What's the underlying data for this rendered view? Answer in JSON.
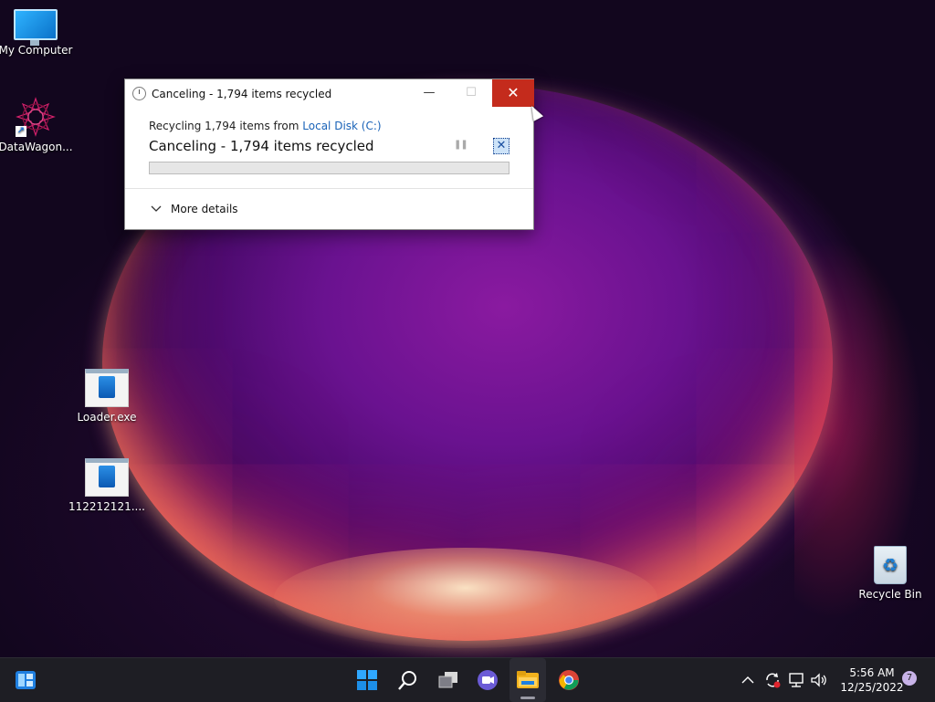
{
  "desktop": {
    "icons": [
      {
        "label": "My Computer"
      },
      {
        "label": "DataWagon..."
      },
      {
        "label": "Loader.exe"
      },
      {
        "label": "112212121...."
      },
      {
        "label": "Recycle Bin"
      }
    ]
  },
  "dialog": {
    "title": "Canceling - 1,794 items recycled",
    "from_prefix": "Recycling 1,794 items from ",
    "from_location": "Local Disk (C:)",
    "status": "Canceling - 1,794 items recycled",
    "progress": 0,
    "more_details": "More details",
    "minimize_glyph": "—",
    "maximize_glyph": "☐",
    "close_glyph": "✕",
    "pause_glyph": "❚❚",
    "cancel_glyph": "✕"
  },
  "taskbar": {
    "pinned": [
      "widgets-icon",
      "start-icon",
      "search-icon",
      "task-view-icon",
      "chat-icon",
      "file-explorer-icon",
      "chrome-icon"
    ],
    "tray": {
      "chevron": "^",
      "time": "5:56 AM",
      "date": "12/25/2022",
      "notification_count": "7"
    }
  },
  "colors": {
    "close_hover": "#c42b1c",
    "link": "#1a63b8",
    "taskbar": "#1e1e24"
  }
}
